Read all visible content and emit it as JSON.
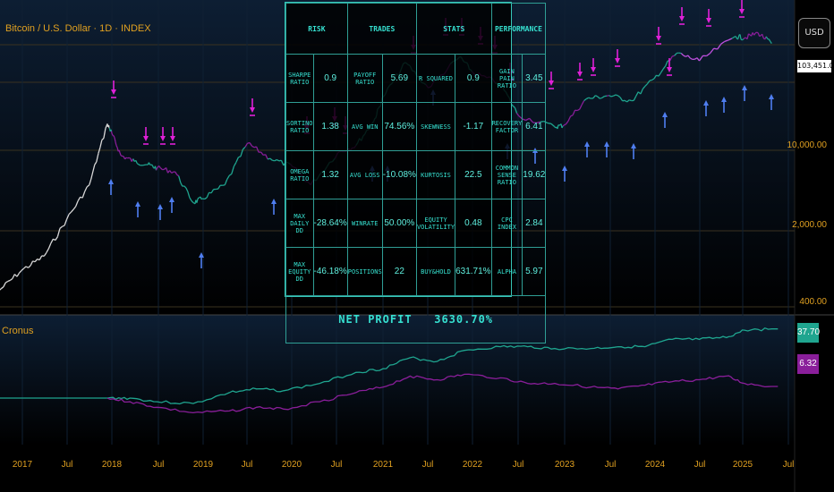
{
  "header": {
    "title": "Bitcoin / U.S. Dollar · 1D · INDEX",
    "currency": "USD",
    "price_box": "103,451.00"
  },
  "indicator": {
    "name": "Cronus",
    "value_green": "37.70",
    "value_purple": "6.32"
  },
  "colors": {
    "green": "#1fa58f",
    "purple": "#8a1e9a",
    "buy_arrow": "#4f7ef0",
    "sell_arrow": "#e020d8",
    "accent_text": "#e0a020",
    "table_text": "#36e0d0"
  },
  "stats_table": {
    "headers": [
      "RISK",
      "TRADES",
      "STATS",
      "PERFORMANCE"
    ],
    "rows": [
      [
        "SHARPE RATIO",
        "0.9",
        "PAYOFF RATIO",
        "5.69",
        "R SQUARED",
        "0.9",
        "GAIN PAIN RATIO",
        "3.45"
      ],
      [
        "SORTINO RATIO",
        "1.38",
        "AVG WIN",
        "74.56%",
        "SKEWNESS",
        "-1.17",
        "RECOVERY FACTOR",
        "6.41"
      ],
      [
        "OMEGA RATIO",
        "1.32",
        "AVG LOSS",
        "-10.08%",
        "KURTOSIS",
        "22.5",
        "COMMON SENSE RATIO",
        "19.62"
      ],
      [
        "MAX DAILY DD",
        "-28.64%",
        "WINRATE",
        "50.00%",
        "EQUITY VOLATILITY",
        "0.48",
        "CPC INDEX",
        "2.84"
      ],
      [
        "MAX EQUITY DD",
        "-46.18%",
        "POSITIONS",
        "22",
        "BUY&HOLD",
        "631.71%",
        "ALPHA",
        "5.97"
      ]
    ],
    "net_profit_label": "NET PROFIT",
    "net_profit_value": "3630.70%"
  },
  "chart_data": [
    {
      "type": "line",
      "scale": "log",
      "y_ticks": [
        "10,000.00",
        "2,000.00",
        "400.00"
      ],
      "x_ticks": [
        "2017",
        "Jul",
        "2018",
        "Jul",
        "2019",
        "Jul",
        "2020",
        "Jul",
        "2021",
        "Jul",
        "2022",
        "Jul",
        "2023",
        "Jul",
        "2024",
        "Jul",
        "2025",
        "Jul"
      ],
      "x": [
        2016.75,
        2017.0,
        2017.25,
        2017.5,
        2017.75,
        2017.95,
        2018.0,
        2018.1,
        2018.25,
        2018.4,
        2018.5,
        2018.7,
        2018.9,
        2019.0,
        2019.25,
        2019.5,
        2019.75,
        2020.0,
        2020.2,
        2020.5,
        2020.7,
        2020.9,
        2021.0,
        2021.25,
        2021.5,
        2021.85,
        2022.0,
        2022.3,
        2022.5,
        2022.9,
        2023.0,
        2023.25,
        2023.5,
        2023.75,
        2024.0,
        2024.25,
        2024.5,
        2024.9,
        2025.0,
        2025.15,
        2025.3
      ],
      "series": [
        {
          "values": [
            600,
            900,
            1200,
            2500,
            5000,
            17000,
            14000,
            9000,
            8000,
            7500,
            7000,
            6500,
            3500,
            3800,
            5000,
            11500,
            8500,
            7200,
            5000,
            9500,
            11000,
            18000,
            29000,
            58000,
            35000,
            65000,
            47000,
            38000,
            20000,
            16000,
            16500,
            28000,
            30000,
            27000,
            42000,
            70000,
            60000,
            98000,
            95000,
            105000,
            85000
          ]
        }
      ]
    },
    {
      "type": "line",
      "x": [
        2017.95,
        2018.2,
        2018.5,
        2018.9,
        2019.3,
        2019.6,
        2019.9,
        2020.3,
        2020.7,
        2021.0,
        2021.3,
        2021.6,
        2021.9,
        2022.3,
        2022.6,
        2022.9,
        2023.3,
        2023.6,
        2023.9,
        2024.2,
        2024.5,
        2024.8,
        2025.0,
        2025.3
      ],
      "series": [
        {
          "values": [
            0,
            0,
            -2,
            -3,
            3,
            5,
            4,
            8,
            14,
            16,
            22,
            20,
            26,
            28,
            28,
            27,
            27,
            28,
            28,
            32,
            32,
            33,
            37,
            37.7
          ]
        },
        {
          "values": [
            0,
            -2,
            -5,
            -8,
            -7,
            -5,
            -6,
            -2,
            3,
            6,
            12,
            10,
            13,
            11,
            8,
            8,
            6,
            5,
            7,
            9,
            10,
            12,
            8,
            6.32
          ]
        }
      ]
    }
  ]
}
